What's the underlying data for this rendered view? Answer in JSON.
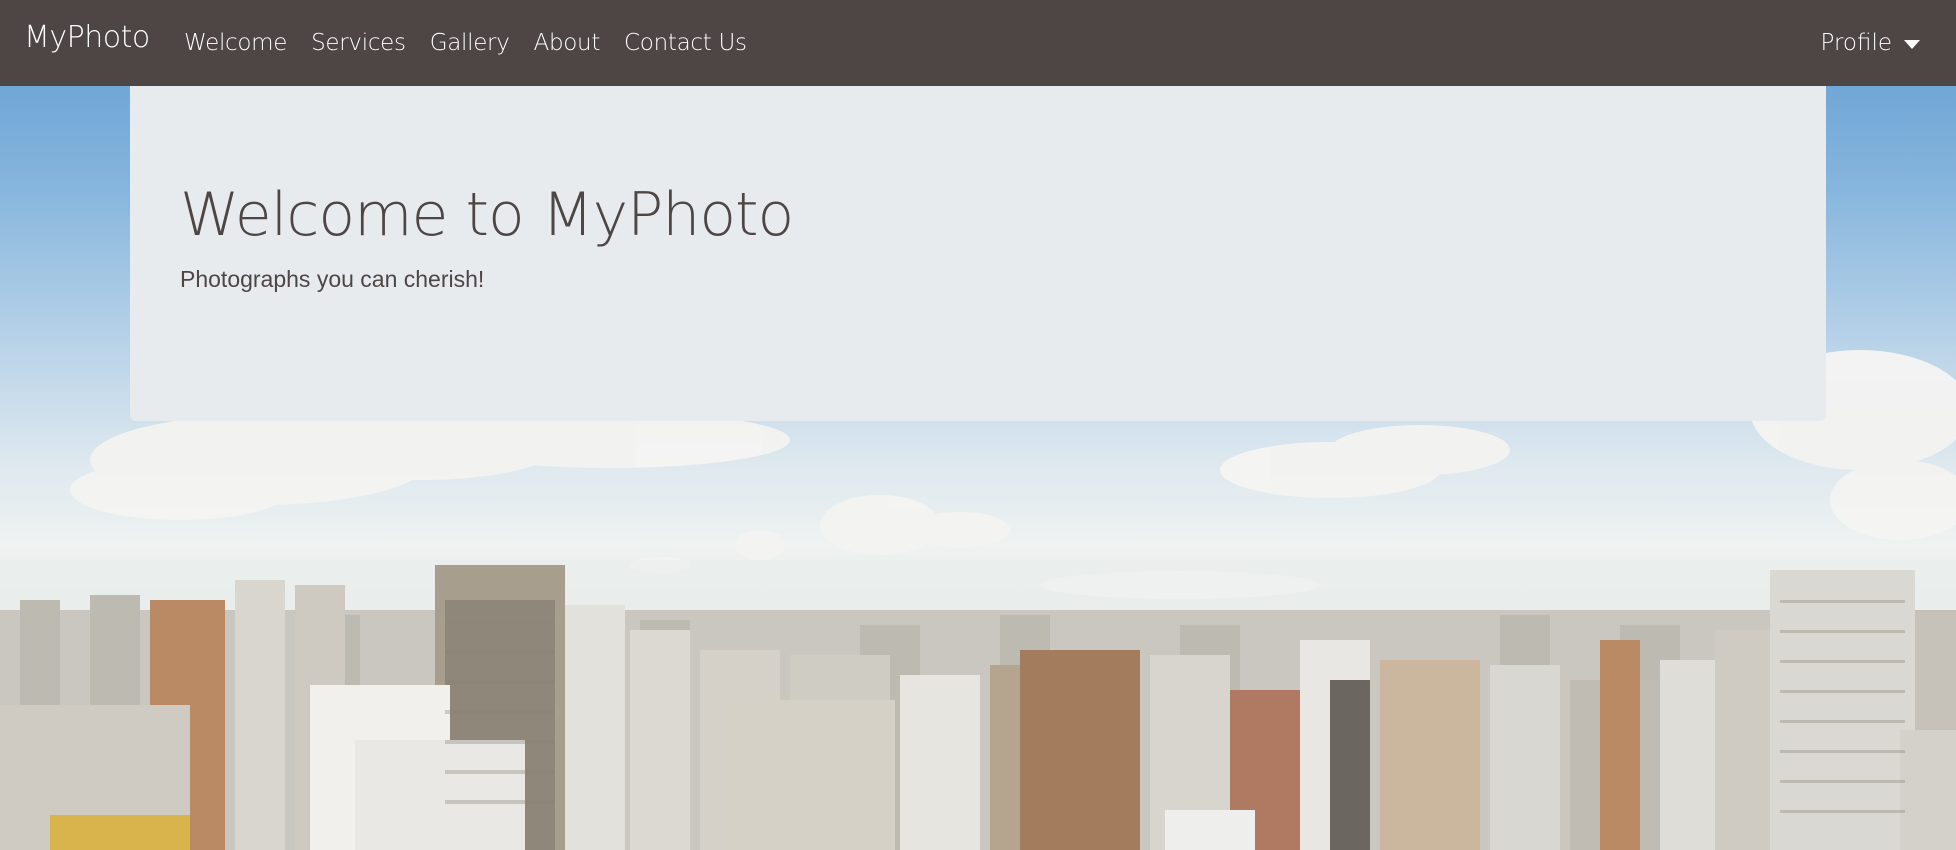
{
  "navbar": {
    "brand": "MyPhoto",
    "links": [
      {
        "label": "Welcome"
      },
      {
        "label": "Services"
      },
      {
        "label": "Gallery"
      },
      {
        "label": "About"
      },
      {
        "label": "Contact Us"
      }
    ],
    "profile_label": "Profile",
    "profile_icon": "caret-down-icon"
  },
  "jumbotron": {
    "title": "Welcome to MyPhoto",
    "subtitle": "Photographs you can cherish!"
  },
  "colors": {
    "navbar_bg": "#4e4545",
    "jumbotron_bg": "#e8ebee",
    "text_dark": "#4e4545",
    "text_light": "#ffffff"
  }
}
